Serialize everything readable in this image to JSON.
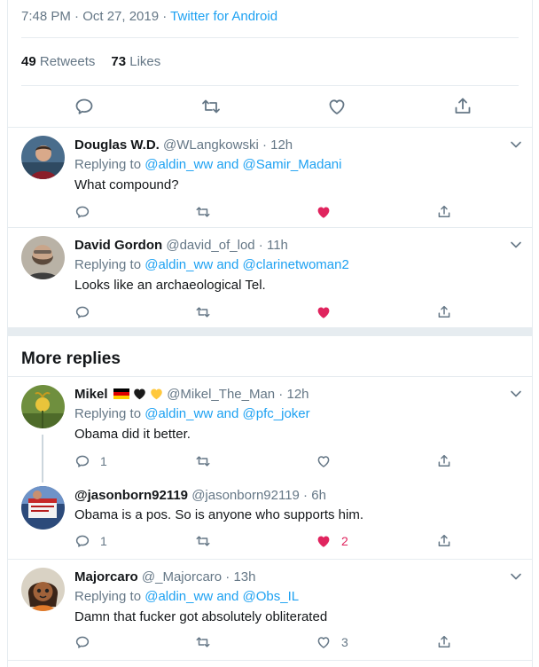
{
  "tweet_meta": {
    "time": "7:48 PM · Oct 27, 2019",
    "separator": " · ",
    "app": "Twitter for Android"
  },
  "stats": {
    "retweets_count": "49",
    "retweets_label": "Retweets",
    "likes_count": "73",
    "likes_label": "Likes"
  },
  "replies": [
    {
      "name": "Douglas W.D.",
      "handle": "@WLangkowski · 12h",
      "replying_prefix": "Replying to ",
      "replying_1": "@aldin_ww",
      "replying_and": " and ",
      "replying_2": "@Samir_Madani",
      "text": "What compound?",
      "liked": true
    },
    {
      "name": "David Gordon",
      "handle": "@david_of_lod · 11h",
      "replying_prefix": "Replying to ",
      "replying_1": "@aldin_ww",
      "replying_and": " and ",
      "replying_2": "@clarinetwoman2",
      "text": "Looks like an archaeological Tel.",
      "liked": true
    }
  ],
  "more_replies": {
    "title": "More replies",
    "items": [
      {
        "name": "Mikel",
        "handle": "@Mikel_The_Man · 12h",
        "replying_prefix": "Replying to ",
        "replying_1": "@aldin_ww",
        "replying_and": " and ",
        "replying_2": "@pfc_joker",
        "text": "Obama did it better.",
        "reply_count": "1",
        "like_count": ""
      },
      {
        "name": "@jasonborn92119",
        "handle": "@jasonborn92119 · 6h",
        "text": "Obama is a pos. So is anyone who supports him.",
        "reply_count": "1",
        "like_count": "2",
        "liked": true
      },
      {
        "name": "Majorcaro",
        "handle": "@_Majorcaro · 13h",
        "replying_prefix": "Replying to ",
        "replying_1": "@aldin_ww",
        "replying_and": " and ",
        "replying_2": "@Obs_IL",
        "text": "Damn that fucker got absolutely obliterated",
        "like_count": "3"
      }
    ]
  },
  "colors": {
    "accent": "#1da1f2",
    "like": "#e0245e",
    "muted": "#657786",
    "border": "#e6ecf0"
  },
  "icons": [
    "reply-icon",
    "retweet-icon",
    "like-icon",
    "share-icon",
    "chevron-down-icon"
  ]
}
